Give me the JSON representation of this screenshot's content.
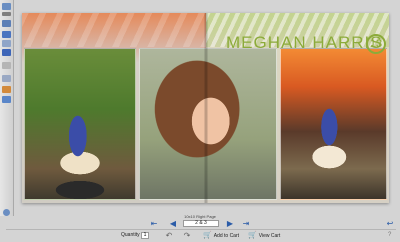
{
  "toolbar": {
    "icons": [
      "select-icon",
      "hand-icon",
      "text-icon",
      "crop-icon",
      "layers-icon",
      "image-icon",
      "page-icon",
      "frame-icon",
      "color-icon",
      "effects-icon",
      "settings-icon"
    ]
  },
  "spread": {
    "title": "MEGHAN HARRIS",
    "badge": "13",
    "photos": [
      "portrait-field-photo",
      "portrait-closeup-photo",
      "portrait-sunset-photo"
    ]
  },
  "footer": {
    "page_label": "10x10 Right Page",
    "page_number": "2 & 3",
    "quantity_label": "Quantity",
    "quantity_value": "1",
    "add_to_cart": "Add to Cart",
    "view_cart": "View Cart"
  },
  "colors": {
    "title_green": "#8cab3a",
    "nav_blue": "#2b5ca8"
  }
}
